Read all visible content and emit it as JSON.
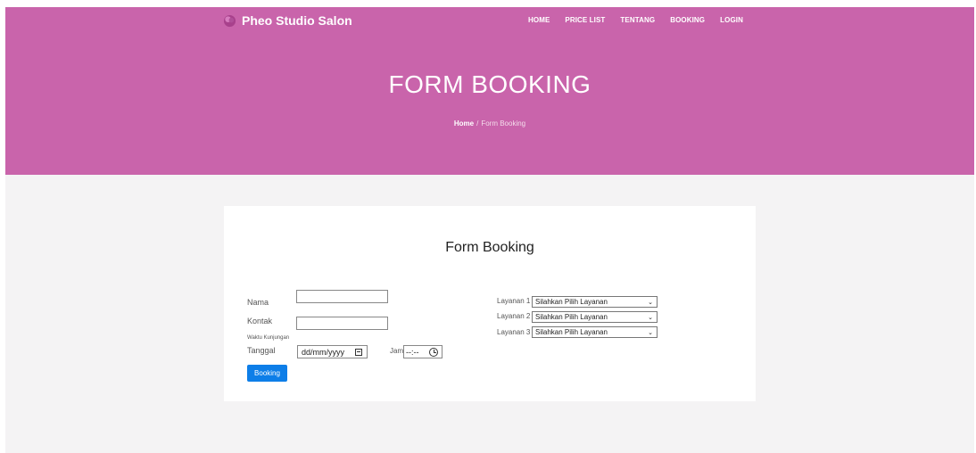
{
  "header": {
    "brand": "Pheo Studio Salon",
    "nav": [
      "HOME",
      "PRICE LIST",
      "TENTANG",
      "BOOKING",
      "LOGIN"
    ]
  },
  "hero": {
    "title": "FORM BOOKING",
    "breadcrumb_home": "Home",
    "breadcrumb_separator": "/",
    "breadcrumb_current": "Form Booking"
  },
  "form": {
    "title": "Form Booking",
    "nama_label": "Nama",
    "nama_value": "",
    "kontak_label": "Kontak",
    "kontak_value": "",
    "waktu_label": "Waktu Kunjungan",
    "tanggal_label": "Tanggal",
    "tanggal_placeholder": "dd/mm/yyyy",
    "jam_label": "Jam",
    "jam_placeholder": "--:--",
    "submit_label": "Booking",
    "layanan": [
      {
        "label": "Layanan 1",
        "selected": "Silahkan Pilih Layanan"
      },
      {
        "label": "Layanan 2",
        "selected": "Silahkan Pilih Layanan"
      },
      {
        "label": "Layanan 3",
        "selected": "Silahkan Pilih Layanan"
      }
    ]
  },
  "colors": {
    "hero_bg": "#c964ab",
    "button_bg": "#0d7ee8",
    "page_bg": "#f4f3f4"
  },
  "icons": [
    "flower-logo-icon",
    "calendar-icon",
    "clock-icon",
    "chevron-down-icon"
  ]
}
